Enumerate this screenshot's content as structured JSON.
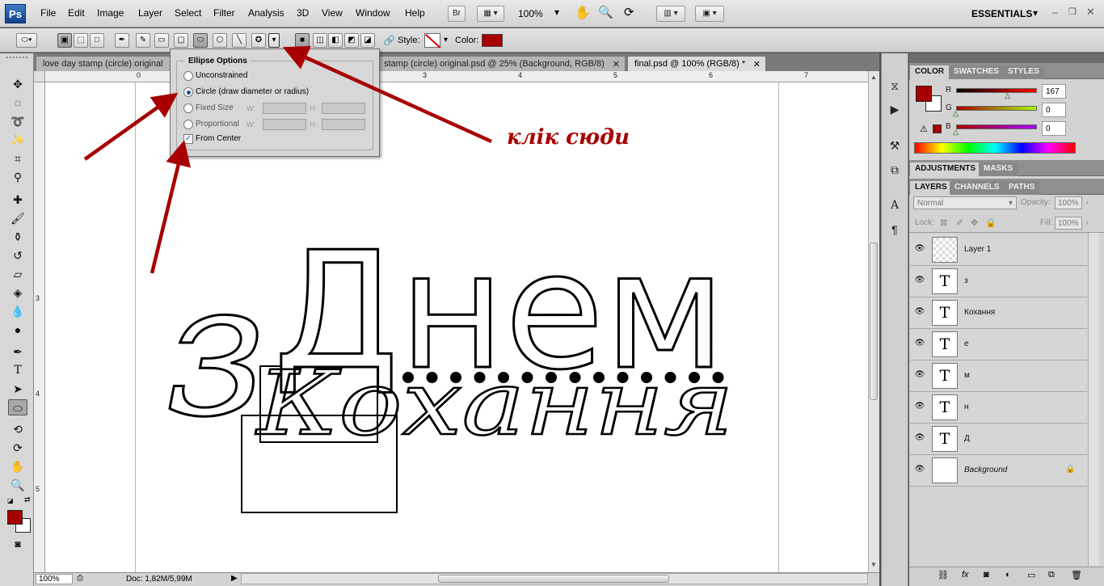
{
  "app": {
    "logo": "Ps"
  },
  "menubar": {
    "items": [
      "File",
      "Edit",
      "Image",
      "Layer",
      "Select",
      "Filter",
      "Analysis",
      "3D",
      "View",
      "Window",
      "Help"
    ],
    "bridge_label": "Br",
    "zoom": "100%",
    "workspace": "ESSENTIALS"
  },
  "options": {
    "style_label": "Style:",
    "color_label": "Color:",
    "color_value": "#a70000"
  },
  "ellipse_options": {
    "title": "Ellipse Options",
    "unconstrained": "Unconstrained",
    "circle": "Circle (draw diameter or radius)",
    "fixed_size": "Fixed Size",
    "proportional": "Proportional",
    "w_label": "W:",
    "h_label": "H:",
    "from_center": "From Center",
    "selected": "circle",
    "from_center_checked": true
  },
  "tabs": [
    {
      "label": "love day stamp (circle) original",
      "active": false
    },
    {
      "label": "stamp (circle) original.psd @ 25% (Background, RGB/8)",
      "active": false
    },
    {
      "label": "final.psd @ 100% (RGB/8) *",
      "active": true
    }
  ],
  "ruler": {
    "h_ticks": [
      "0",
      "3",
      "4",
      "5",
      "6",
      "7"
    ],
    "v_ticks": [
      "3",
      "4",
      "5"
    ]
  },
  "artwork": {
    "line1_small": "з",
    "line1_big": "Днем",
    "line2": "Кохання"
  },
  "annotation": "клік сюди",
  "status": {
    "zoom": "100%",
    "doc": "Doc: 1,82M/5,99M"
  },
  "color_panel": {
    "tabs": [
      "COLOR",
      "SWATCHES",
      "STYLES"
    ],
    "r_label": "R",
    "g_label": "G",
    "b_label": "B",
    "r": "167",
    "g": "0",
    "b": "0",
    "fg": "#a70000"
  },
  "adjust_panel": {
    "tabs": [
      "ADJUSTMENTS",
      "MASKS"
    ]
  },
  "layers_panel": {
    "tabs": [
      "LAYERS",
      "CHANNELS",
      "PATHS"
    ],
    "blend_mode": "Normal",
    "opacity_label": "Opacity:",
    "opacity": "100%",
    "lock_label": "Lock:",
    "fill_label": "Fill:",
    "fill": "100%",
    "layers": [
      {
        "name": "Layer 1",
        "type": "raster"
      },
      {
        "name": "з",
        "type": "text"
      },
      {
        "name": "Кохання",
        "type": "text"
      },
      {
        "name": "е",
        "type": "text"
      },
      {
        "name": "м",
        "type": "text"
      },
      {
        "name": "н",
        "type": "text"
      },
      {
        "name": "Д",
        "type": "text"
      },
      {
        "name": "Background",
        "type": "background"
      }
    ],
    "text_thumb_glyph": "T"
  }
}
